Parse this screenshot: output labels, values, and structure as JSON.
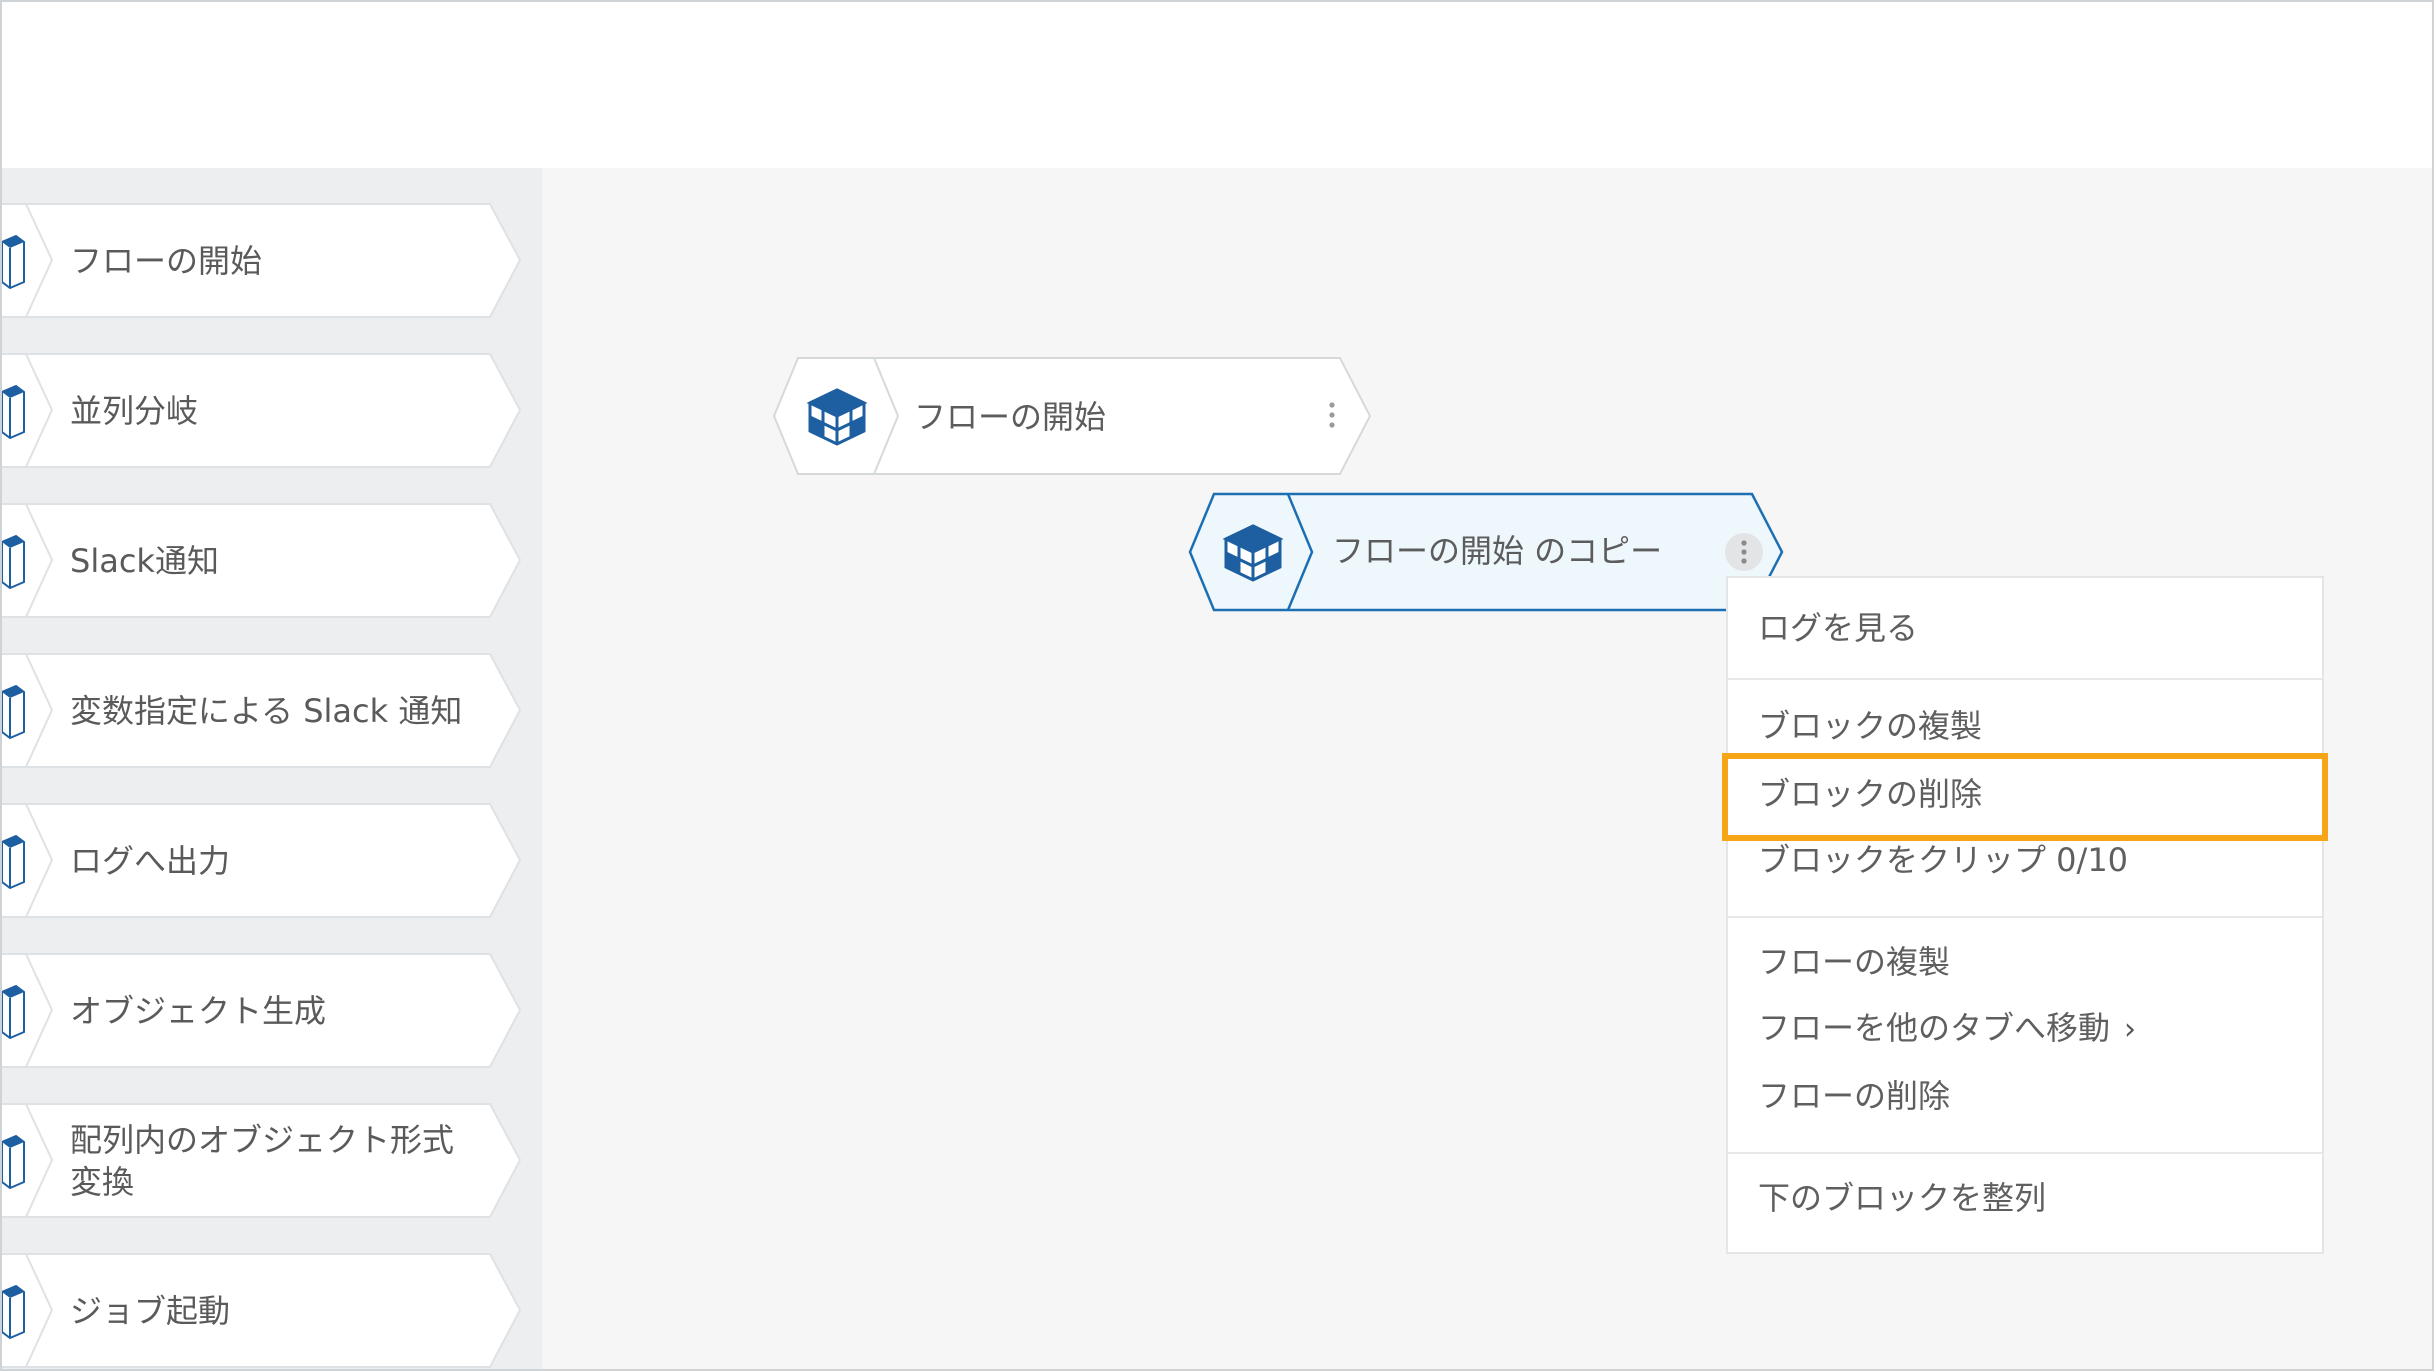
{
  "palette": {
    "items": [
      {
        "label": "フローの開始"
      },
      {
        "label": "並列分岐"
      },
      {
        "label": "Slack通知"
      },
      {
        "label": "変数指定による Slack 通知"
      },
      {
        "label": "ログへ出力"
      },
      {
        "label": "オブジェクト生成"
      },
      {
        "label": "配列内のオブジェクト形式変換"
      },
      {
        "label": "ジョブ起動"
      }
    ]
  },
  "canvas": {
    "blocks": [
      {
        "label": "フローの開始",
        "selected": false
      },
      {
        "label": "フローの開始 のコピー",
        "selected": true
      }
    ]
  },
  "context_menu": {
    "view_log": "ログを見る",
    "duplicate_block": "ブロックの複製",
    "delete_block": "ブロックの削除",
    "clip_block": "ブロックをクリップ 0/10",
    "duplicate_flow": "フローの複製",
    "move_flow": "フローを他のタブへ移動",
    "delete_flow": "フローの削除",
    "align_below": "下のブロックを整列"
  },
  "colors": {
    "accent_blue": "#1d6fb3",
    "highlight": "#f5a516",
    "selected_block_bg": "#eef7fc"
  }
}
